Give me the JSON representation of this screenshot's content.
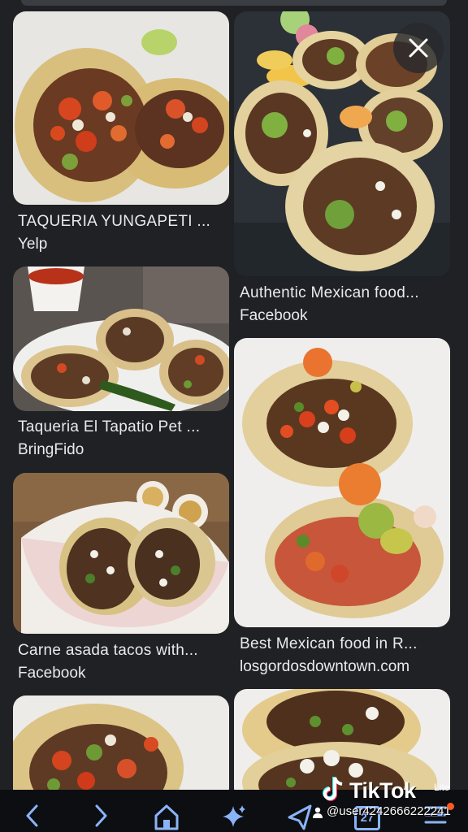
{
  "results": [
    {
      "title": "TAQUERIA YUNGAPETI ...",
      "source": "Yelp"
    },
    {
      "title": "Authentic Mexican food...",
      "source": "Facebook"
    },
    {
      "title": "Taqueria El Tapatio Pet ...",
      "source": "BringFido"
    },
    {
      "title": "Best Mexican food in R...",
      "source": "losgordosdowntown.com"
    },
    {
      "title": "Carne asada tacos with...",
      "source": "Facebook"
    }
  ],
  "toolbar": {
    "icons": [
      "back-icon",
      "forward-icon",
      "home-icon",
      "sparkle-icon",
      "share-icon",
      "calendar-icon",
      "menu-icon"
    ],
    "calendar_day": "27"
  },
  "watermark": {
    "brand": "TikTok",
    "lite": "Lite",
    "user": "@user4242666222241"
  }
}
